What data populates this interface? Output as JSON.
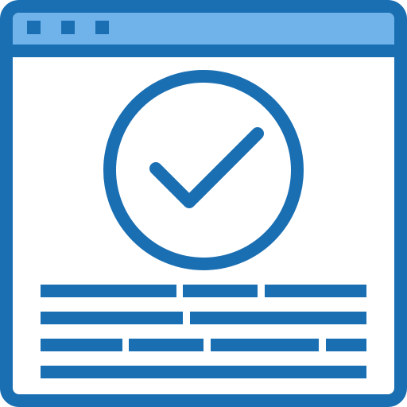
{
  "icon": {
    "name": "web-page-check-icon",
    "symbol": "checkmark-icon"
  },
  "colors": {
    "accent": "#1a6fb3",
    "title_bar": "#6fb3ea",
    "background": "#ffffff"
  },
  "window_controls": [
    "dot",
    "dot",
    "dot"
  ],
  "text_placeholder_rows": 4
}
